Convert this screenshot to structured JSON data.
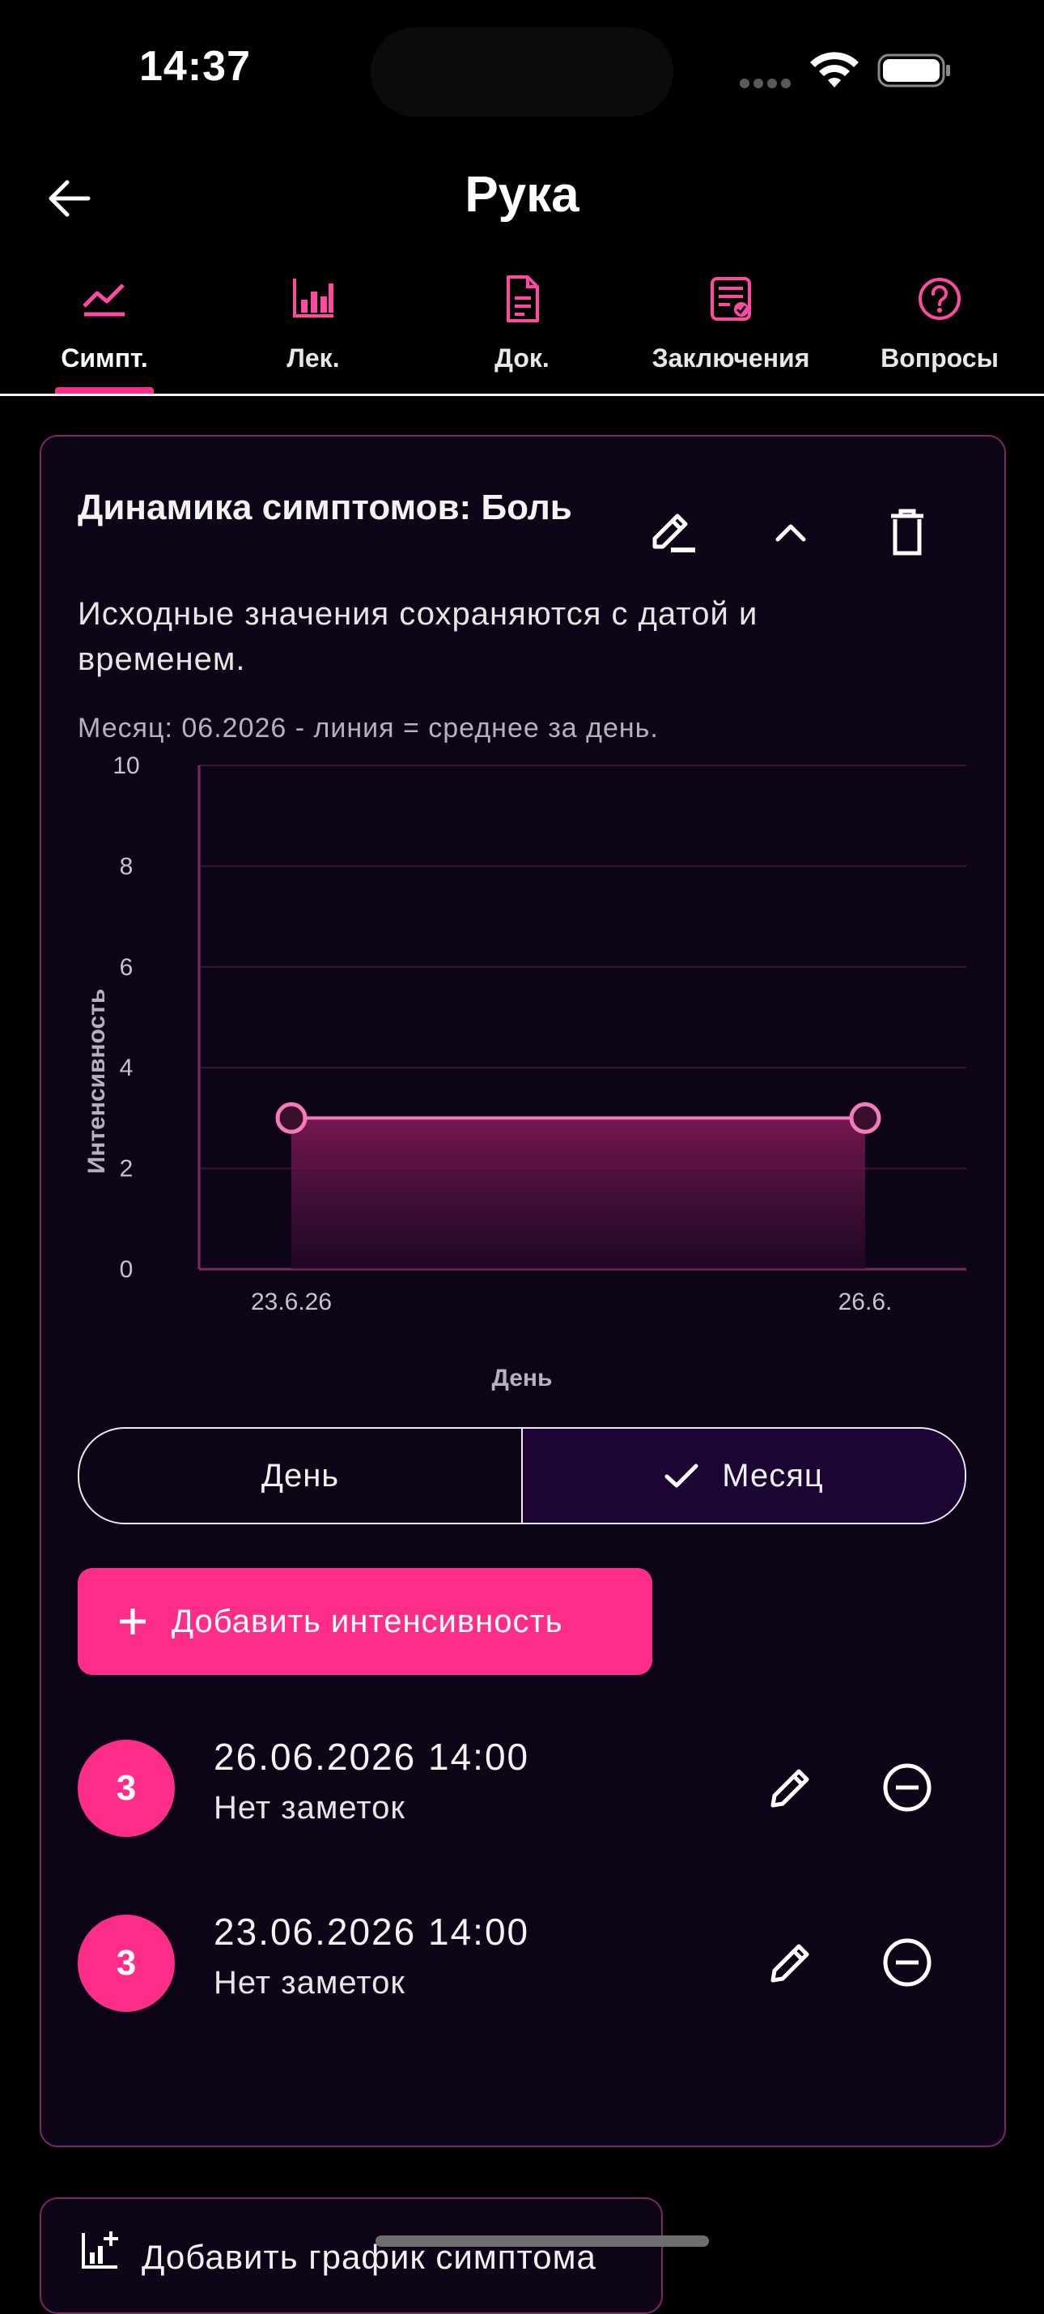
{
  "status_bar": {
    "time": "14:37"
  },
  "app_bar": {
    "title": "Рука"
  },
  "tabs": [
    {
      "label": "Симпт.",
      "icon": "chart-line-icon",
      "active": true
    },
    {
      "label": "Лек.",
      "icon": "bar-chart-icon",
      "active": false
    },
    {
      "label": "Док.",
      "icon": "document-icon",
      "active": false
    },
    {
      "label": "Заключения",
      "icon": "report-icon",
      "active": false
    },
    {
      "label": "Вопросы",
      "icon": "help-circle-icon",
      "active": false
    }
  ],
  "card": {
    "title": "Динамика симптомов: Боль",
    "description": "Исходные значения сохраняются с датой и временем.",
    "chart_caption": "Месяц: 06.2026 - линия = среднее за день."
  },
  "chart_data": {
    "type": "line",
    "x": [
      "23.6.26",
      "26.6."
    ],
    "values": [
      3,
      3
    ],
    "xlabel": "День",
    "ylabel": "Интенсивность",
    "ylim": [
      0,
      10
    ],
    "y_ticks": [
      "0",
      "2",
      "4",
      "6",
      "8",
      "10"
    ],
    "grid": true,
    "fill": "area-under-line",
    "line_color": "#f27bb8"
  },
  "segmented": {
    "options": [
      "День",
      "Месяц"
    ],
    "selected": "Месяц"
  },
  "add_intensity_label": "Добавить интенсивность",
  "entries": [
    {
      "value": "3",
      "datetime": "26.06.2026 14:00",
      "note": "Нет заметок"
    },
    {
      "value": "3",
      "datetime": "23.06.2026 14:00",
      "note": "Нет заметок"
    }
  ],
  "add_chart_label": "Добавить график симптома",
  "colors": {
    "accent": "#ff2d8a",
    "card_background": "#0d0418",
    "card_border": "#7a2a5e"
  }
}
